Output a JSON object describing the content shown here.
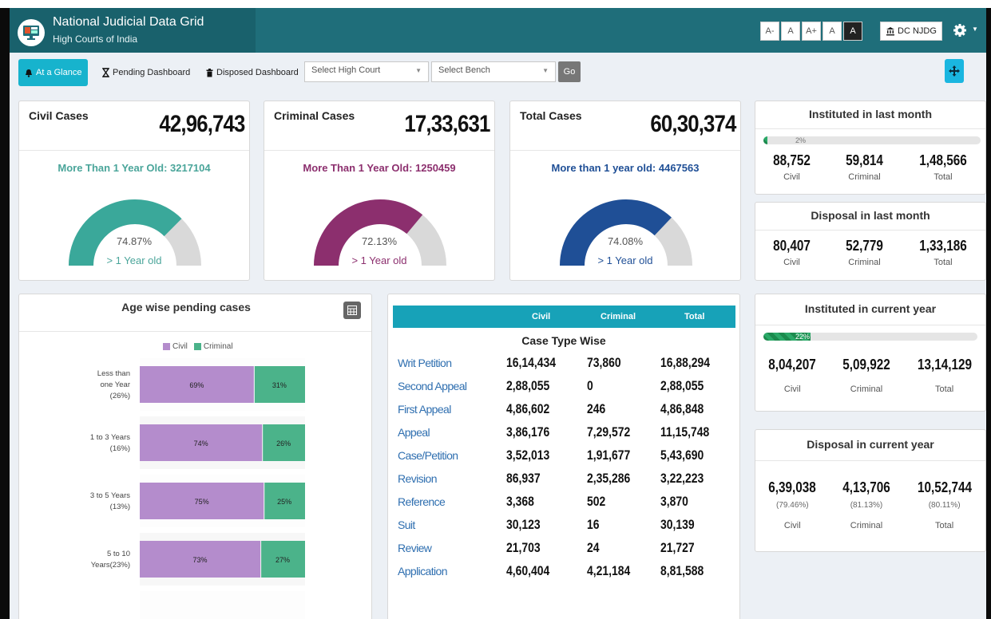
{
  "header": {
    "title": "National Judicial Data Grid",
    "subtitle": "High Courts of India",
    "font_buttons": [
      "A-",
      "A",
      "A+",
      "A",
      "A"
    ],
    "dc_button": "DC NJDG"
  },
  "toolbar": {
    "tabs": [
      {
        "label": "At a Glance",
        "icon": "bell-icon",
        "active": true
      },
      {
        "label": "Pending Dashboard",
        "icon": "hourglass-icon",
        "active": false
      },
      {
        "label": "Disposed Dashboard",
        "icon": "trash-icon",
        "active": false
      }
    ],
    "select_high_court": "Select High Court",
    "select_bench": "Select Bench",
    "go": "Go"
  },
  "summary": [
    {
      "label": "Civil Cases",
      "value": "42,96,743",
      "old_text": "More Than 1 Year Old: 3217104",
      "percent": 74.87,
      "percent_text": "74.87%",
      "gauge_sub": "> 1 Year old",
      "color": "#3aa89a",
      "text_color": "#4aa59a"
    },
    {
      "label": "Criminal Cases",
      "value": "17,33,631",
      "old_text": "More Than 1 Year Old: 1250459",
      "percent": 72.13,
      "percent_text": "72.13%",
      "gauge_sub": "> 1 Year old",
      "color": "#8c2f6e",
      "text_color": "#8c2f6e"
    },
    {
      "label": "Total Cases",
      "value": "60,30,374",
      "old_text": "More than 1 year old: 4467563",
      "percent": 74.08,
      "percent_text": "74.08%",
      "gauge_sub": "> 1 Year old",
      "color": "#1f4f96",
      "text_color": "#1f4f96"
    }
  ],
  "instituted_last_month": {
    "title": "Instituted in last month",
    "progress": 2,
    "progress_text": "2%",
    "civil": "88,752",
    "criminal": "59,814",
    "total": "1,48,566",
    "labels": [
      "Civil",
      "Criminal",
      "Total"
    ]
  },
  "disposal_last_month": {
    "title": "Disposal in last month",
    "civil": "80,407",
    "criminal": "52,779",
    "total": "1,33,186",
    "labels": [
      "Civil",
      "Criminal",
      "Total"
    ]
  },
  "instituted_current_year": {
    "title": "Instituted in current year",
    "progress": 22,
    "progress_text": "22%",
    "civil": "8,04,207",
    "criminal": "5,09,922",
    "total": "13,14,129",
    "labels": [
      "Civil",
      "Criminal",
      "Total"
    ]
  },
  "disposal_current_year": {
    "title": "Disposal in current year",
    "civil": "6,39,038",
    "criminal": "4,13,706",
    "total": "10,52,744",
    "civil_pct": "(79.46%)",
    "criminal_pct": "(81.13%)",
    "total_pct": "(80.11%)",
    "labels": [
      "Civil",
      "Criminal",
      "Total"
    ]
  },
  "age_wise": {
    "title": "Age wise pending cases",
    "legend": [
      "Civil",
      "Criminal"
    ],
    "colors": {
      "civil": "#b48ccc",
      "criminal": "#4bb38a"
    }
  },
  "chart_data": {
    "type": "bar",
    "orientation": "horizontal",
    "stacked": true,
    "categories": [
      [
        "Less than",
        "one Year",
        "(26%)"
      ],
      [
        "1 to 3 Years",
        "(16%)"
      ],
      [
        "3 to 5 Years",
        "(13%)"
      ],
      [
        "5 to 10",
        "Years(23%)"
      ]
    ],
    "series": [
      {
        "name": "Civil",
        "values": [
          69,
          74,
          75,
          73
        ],
        "labels": [
          "69%",
          "74%",
          "75%",
          "73%"
        ]
      },
      {
        "name": "Criminal",
        "values": [
          31,
          26,
          25,
          27
        ],
        "labels": [
          "31%",
          "26%",
          "25%",
          "27%"
        ]
      }
    ]
  },
  "case_type": {
    "headers": [
      "Civil",
      "Criminal",
      "Total"
    ],
    "title": "Case Type Wise",
    "rows": [
      {
        "name": "Writ Petition",
        "civil": "16,14,434",
        "criminal": "73,860",
        "total": "16,88,294"
      },
      {
        "name": "Second Appeal",
        "civil": "2,88,055",
        "criminal": "0",
        "total": "2,88,055"
      },
      {
        "name": "First Appeal",
        "civil": "4,86,602",
        "criminal": "246",
        "total": "4,86,848"
      },
      {
        "name": "Appeal",
        "civil": "3,86,176",
        "criminal": "7,29,572",
        "total": "11,15,748"
      },
      {
        "name": "Case/Petition",
        "civil": "3,52,013",
        "criminal": "1,91,677",
        "total": "5,43,690"
      },
      {
        "name": "Revision",
        "civil": "86,937",
        "criminal": "2,35,286",
        "total": "3,22,223"
      },
      {
        "name": "Reference",
        "civil": "3,368",
        "criminal": "502",
        "total": "3,870"
      },
      {
        "name": "Suit",
        "civil": "30,123",
        "criminal": "16",
        "total": "30,139"
      },
      {
        "name": "Review",
        "civil": "21,703",
        "criminal": "24",
        "total": "21,727"
      },
      {
        "name": "Application",
        "civil": "4,60,404",
        "criminal": "4,21,184",
        "total": "8,81,588"
      }
    ]
  }
}
